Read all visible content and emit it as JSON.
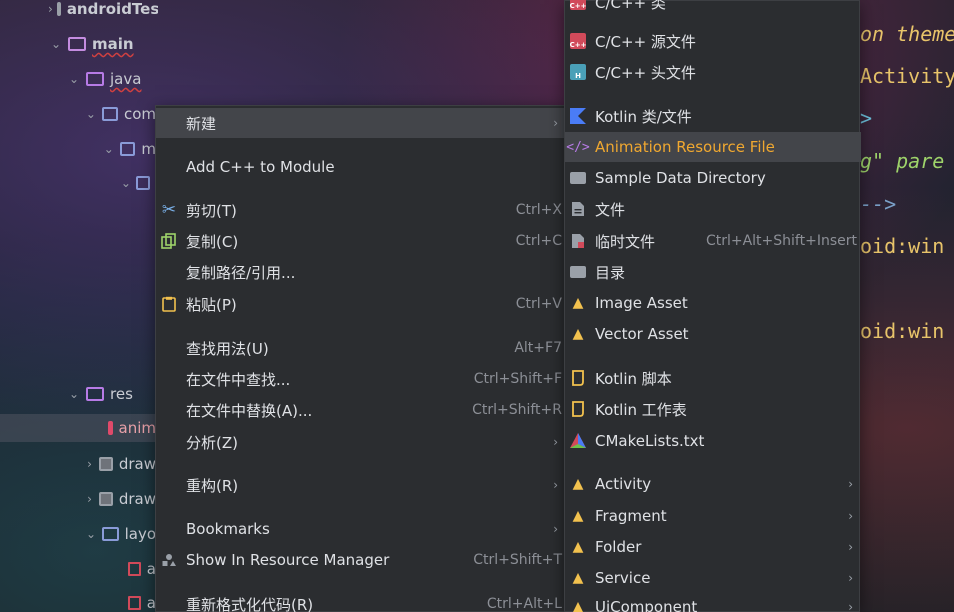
{
  "project_tree": {
    "items": [
      {
        "label": "androidTest",
        "chev": "›",
        "icon": "folder-icon"
      },
      {
        "label": "main",
        "chev": "⌄",
        "icon": "folder-icon"
      },
      {
        "label": "java",
        "chev": "⌄",
        "icon": "source-folder-icon"
      },
      {
        "label": "com",
        "chev": "⌄",
        "icon": "package-icon"
      },
      {
        "label": "m",
        "chev": "⌄",
        "icon": "package-icon"
      },
      {
        "label": "",
        "chev": "⌄",
        "icon": "package-icon"
      },
      {
        "label": "res",
        "chev": "⌄",
        "icon": "resource-folder-icon"
      },
      {
        "label": "anim",
        "chev": "",
        "icon": "anim-folder-icon"
      },
      {
        "label": "draw",
        "chev": "›",
        "icon": "folder-icon"
      },
      {
        "label": "draw",
        "chev": "›",
        "icon": "folder-icon"
      },
      {
        "label": "layo",
        "chev": "⌄",
        "icon": "layout-folder-icon"
      },
      {
        "label": "a",
        "chev": "",
        "icon": "layout-file-icon"
      },
      {
        "label": "a",
        "chev": "",
        "icon": "layout-file-icon"
      }
    ]
  },
  "editor": {
    "lines": [
      "on theme",
      "Activity",
      ">",
      "g\" pare",
      "-->",
      "oid:win",
      "oid:win"
    ]
  },
  "context_menu": {
    "items": [
      {
        "label": "新建",
        "shortcut": "",
        "submenu": true
      },
      {
        "label": "Add C++ to Module",
        "shortcut": ""
      },
      {
        "label": "剪切(T)",
        "shortcut": "Ctrl+X"
      },
      {
        "label": "复制(C)",
        "shortcut": "Ctrl+C"
      },
      {
        "label": "复制路径/引用...",
        "shortcut": ""
      },
      {
        "label": "粘贴(P)",
        "shortcut": "Ctrl+V"
      },
      {
        "label": "查找用法(U)",
        "shortcut": "Alt+F7"
      },
      {
        "label": "在文件中查找...",
        "shortcut": "Ctrl+Shift+F"
      },
      {
        "label": "在文件中替换(A)...",
        "shortcut": "Ctrl+Shift+R"
      },
      {
        "label": "分析(Z)",
        "shortcut": "",
        "submenu": true
      },
      {
        "label": "重构(R)",
        "shortcut": "",
        "submenu": true
      },
      {
        "label": "Bookmarks",
        "shortcut": "",
        "submenu": true
      },
      {
        "label": "Show In Resource Manager",
        "shortcut": "Ctrl+Shift+T"
      },
      {
        "label": "重新格式化代码(R)",
        "shortcut": "Ctrl+Alt+L"
      }
    ]
  },
  "submenu": {
    "items": [
      {
        "label": "C/C++ 类",
        "shortcut": ""
      },
      {
        "label": "C/C++ 源文件",
        "shortcut": ""
      },
      {
        "label": "C/C++ 头文件",
        "shortcut": ""
      },
      {
        "label": "Kotlin 类/文件",
        "shortcut": ""
      },
      {
        "label": "Animation Resource File",
        "shortcut": ""
      },
      {
        "label": "Sample Data Directory",
        "shortcut": ""
      },
      {
        "label": "文件",
        "shortcut": ""
      },
      {
        "label": "临时文件",
        "shortcut": "Ctrl+Alt+Shift+Insert"
      },
      {
        "label": "目录",
        "shortcut": ""
      },
      {
        "label": "Image Asset",
        "shortcut": ""
      },
      {
        "label": "Vector Asset",
        "shortcut": ""
      },
      {
        "label": "Kotlin 脚本",
        "shortcut": ""
      },
      {
        "label": "Kotlin 工作表",
        "shortcut": ""
      },
      {
        "label": "CMakeLists.txt",
        "shortcut": ""
      },
      {
        "label": "Activity",
        "shortcut": "",
        "submenu": true
      },
      {
        "label": "Fragment",
        "shortcut": "",
        "submenu": true
      },
      {
        "label": "Folder",
        "shortcut": "",
        "submenu": true
      },
      {
        "label": "Service",
        "shortcut": "",
        "submenu": true
      },
      {
        "label": "UiComponent",
        "shortcut": "",
        "submenu": true
      }
    ]
  },
  "colors": {
    "menu_bg": "#2b2d30",
    "highlight": "#43454a",
    "highlight_text": "#f0a830",
    "android_green_icon": "#f2c14e",
    "kotlin_blue": "#4a7cf6",
    "code_yellow": "#e8c46a",
    "code_cyan": "#6fc3df"
  }
}
